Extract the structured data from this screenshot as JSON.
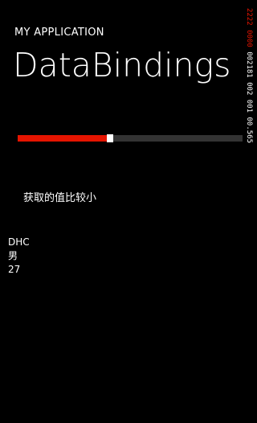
{
  "app": {
    "title": "MY APPLICATION",
    "page_title": "DataBindings"
  },
  "slider": {
    "value": 0.4,
    "fill_color": "#e51400",
    "track_color": "#333333",
    "thumb_color": "#ffffff"
  },
  "result_text": "获取的值比较小",
  "person": {
    "name": "DHC",
    "gender": "男",
    "age": "27"
  },
  "frame_counter": {
    "accent": "2222 0000",
    "rest": " 002181 002 001 00.565",
    "accent_color": "#e51400"
  }
}
